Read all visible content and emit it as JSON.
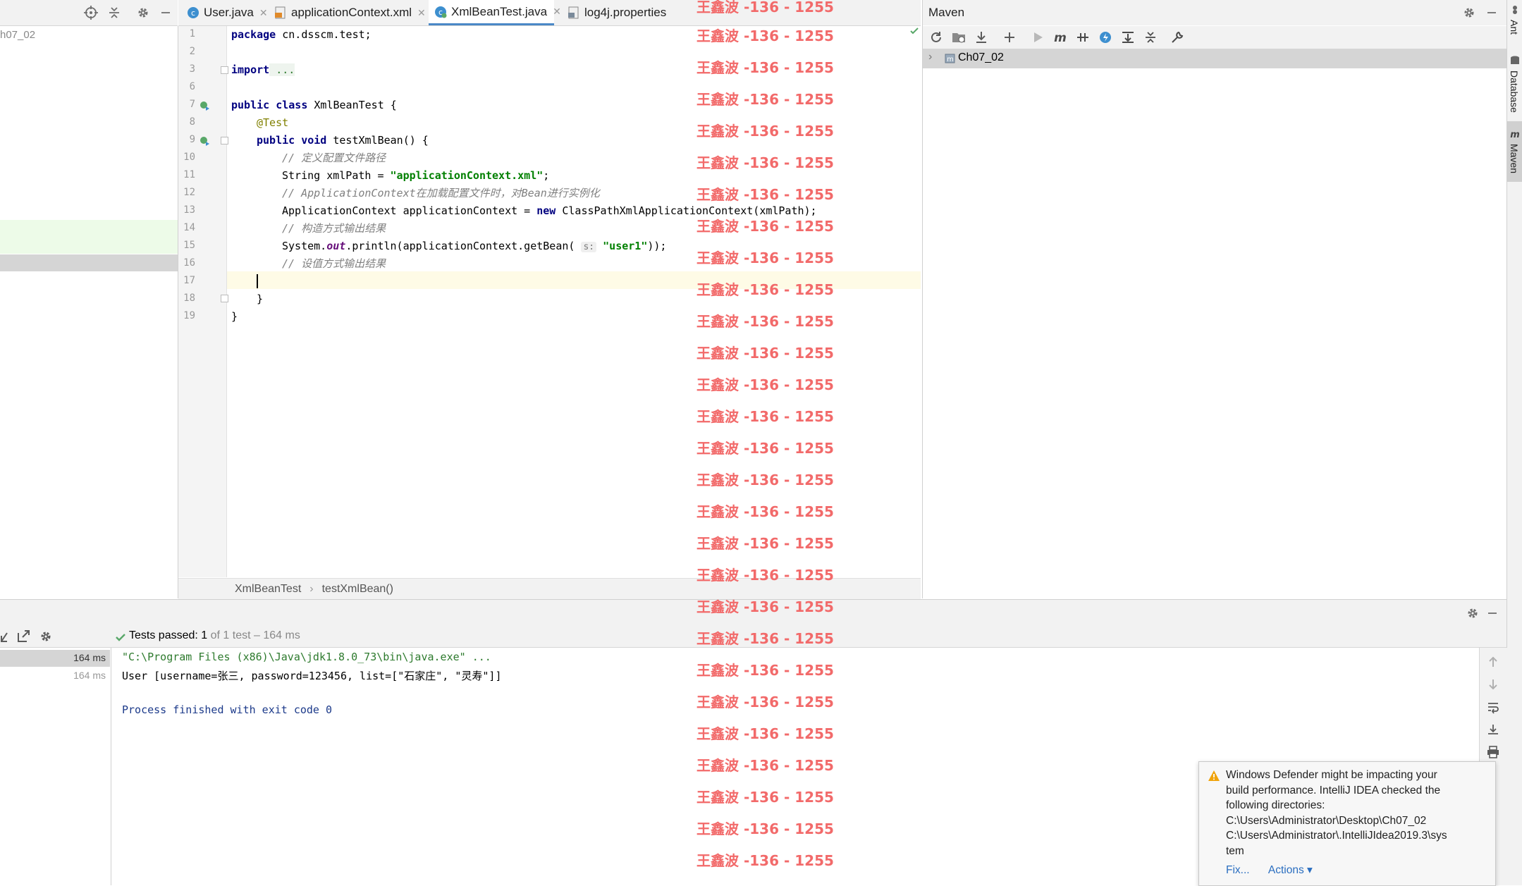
{
  "project": {
    "root_label": "h07_02"
  },
  "tabs": [
    {
      "label": "User.java",
      "icon": "class-icon",
      "active": false
    },
    {
      "label": "applicationContext.xml",
      "icon": "xml-icon",
      "active": false
    },
    {
      "label": "XmlBeanTest.java",
      "icon": "test-class-icon",
      "active": true
    },
    {
      "label": "log4j.properties",
      "icon": "properties-icon",
      "active": false
    }
  ],
  "editor": {
    "lines": {
      "l1": {
        "no": "1"
      },
      "l2": {
        "no": "2"
      },
      "l3": {
        "no": "3"
      },
      "l6": {
        "no": "6"
      },
      "l7": {
        "no": "7"
      },
      "l8": {
        "no": "8"
      },
      "l9": {
        "no": "9"
      },
      "l10": {
        "no": "10"
      },
      "l11": {
        "no": "11"
      },
      "l12": {
        "no": "12"
      },
      "l13": {
        "no": "13"
      },
      "l14": {
        "no": "14"
      },
      "l15": {
        "no": "15"
      },
      "l16": {
        "no": "16"
      },
      "l17": {
        "no": "17"
      },
      "l18": {
        "no": "18"
      },
      "l19": {
        "no": "19"
      }
    },
    "code": {
      "kw_package": "package",
      "pkg_name": " cn.dsscm.test;",
      "kw_import": "import",
      "import_fold": " ...",
      "kw_public_class": "public class",
      "class_name": " XmlBeanTest {",
      "annotation": "@Test",
      "kw_public_void": "public void",
      "method_sig": " testXmlBean() {",
      "comment1": "// 定义配置文件路径",
      "line11_a": "String xmlPath = ",
      "line11_str": "\"applicationContext.xml\"",
      "line11_b": ";",
      "comment2": "// ApplicationContext在加载配置文件时，对Bean进行实例化",
      "line13_a": "ApplicationContext applicationContext = ",
      "line13_kw": "new",
      "line13_b": " ClassPathXmlApplicationContext(xmlPath);",
      "comment3": "// 构造方式输出结果",
      "line15_a": "System.",
      "line15_field": "out",
      "line15_b": ".println(applicationContext.getBean( ",
      "line15_hint": "s:",
      "line15_str": " \"user1\"",
      "line15_c": "));",
      "comment4": "// 设值方式输出结果",
      "close_method": "}",
      "close_class": "}"
    },
    "breadcrumb": {
      "class": "XmlBeanTest",
      "method": "testXmlBean()"
    }
  },
  "maven": {
    "title": "Maven",
    "project": "Ch07_02"
  },
  "right_strip": {
    "ant": "Ant",
    "database": "Database",
    "maven": "Maven"
  },
  "run": {
    "status_label": "Tests passed:",
    "status_count": "1",
    "status_rest": "of 1 test – 164 ms",
    "tree": [
      {
        "time": "164 ms"
      },
      {
        "time": "164 ms"
      }
    ],
    "console": {
      "line1": "\"C:\\Program Files (x86)\\Java\\jdk1.8.0_73\\bin\\java.exe\" ...",
      "line2": "User [username=张三, password=123456, list=[\"石家庄\", \"灵寿\"]]",
      "line3": "Process finished with exit code 0"
    }
  },
  "notification": {
    "line1": "Windows Defender might be impacting your",
    "line2": "build performance. IntelliJ IDEA checked the",
    "line3": "following directories:",
    "line4": "C:\\Users\\Administrator\\Desktop\\Ch07_02",
    "line5": "C:\\Users\\Administrator\\.IntelliJIdea2019.3\\sys",
    "line6": "tem",
    "fix": "Fix...",
    "actions": "Actions ▾"
  },
  "watermark": {
    "text": "王鑫波 -136 - 1255"
  },
  "colors": {
    "accent": "#4a88c7",
    "watermark": "#f26a6a",
    "keyword": "#000080",
    "string": "#008000",
    "comment": "#808080",
    "console_blue": "#1c3a8a",
    "console_green": "#2d7a2d"
  }
}
